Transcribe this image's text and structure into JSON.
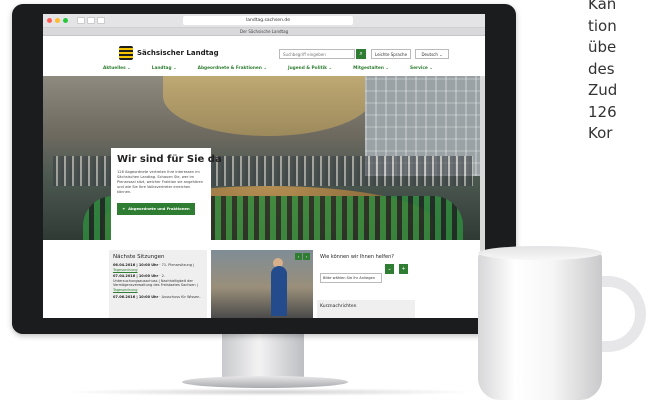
{
  "browser": {
    "url": "landtag.sachsen.de",
    "tab_title": "Der Sächsische Landtag"
  },
  "site": {
    "logo_text": "Sächsischer Landtag",
    "search_placeholder": "Suchbegriff eingeben",
    "search_icon": "search-icon",
    "leichte_sprache": "Leichte Sprache",
    "language": "Deutsch ⌄",
    "menu": [
      "Aktuelles ⌄",
      "Landtag ⌄",
      "Abgeordnete & Fraktionen ⌄",
      "Jugend & Politik ⌄",
      "Mitgestalten ⌄",
      "Service ⌄"
    ]
  },
  "hero": {
    "title": "Wir sind für Sie da",
    "text": "126 Abgeordnete vertreten Ihre Interessen im Sächsischen Landtag. Schauen Sie, wer im Plenarsaal sitzt, welcher Fraktion sie angehören und wie Sie Ihre Volksvertreter erreichen können.",
    "button": "Abgeordnete und Fraktionen",
    "button_icon": "plus-icon"
  },
  "sessions": {
    "title": "Nächste Sitzungen",
    "items": [
      {
        "date": "06.04.2016 | 10:00 Uhr",
        "text": " · 71. Plenarsitzung |",
        "link": "Tagesordnung"
      },
      {
        "date": "07.04.2016 | 10:00 Uhr",
        "text": " · 2. Untersuchungsausschuss | Nachhaltigkeit der Vermögensverwaltung des Freistaates Sachsen | ",
        "link": "Tagesordnung"
      },
      {
        "date": "07.06.2016 | 10:00 Uhr",
        "text": " · Ausschuss für Wissen-",
        "link": ""
      }
    ]
  },
  "help": {
    "title": "Wie können wir Ihnen helfen?",
    "select": "Bitte wählen Sie Ihr Anliegen",
    "news": "Kurznachrichten"
  },
  "side_text": [
    "Kan",
    "tion",
    "übe",
    "des",
    "Zud",
    "126",
    "Kor"
  ],
  "colors": {
    "accent_green": "#2e7d32",
    "monitor": "#1b1c1e"
  }
}
